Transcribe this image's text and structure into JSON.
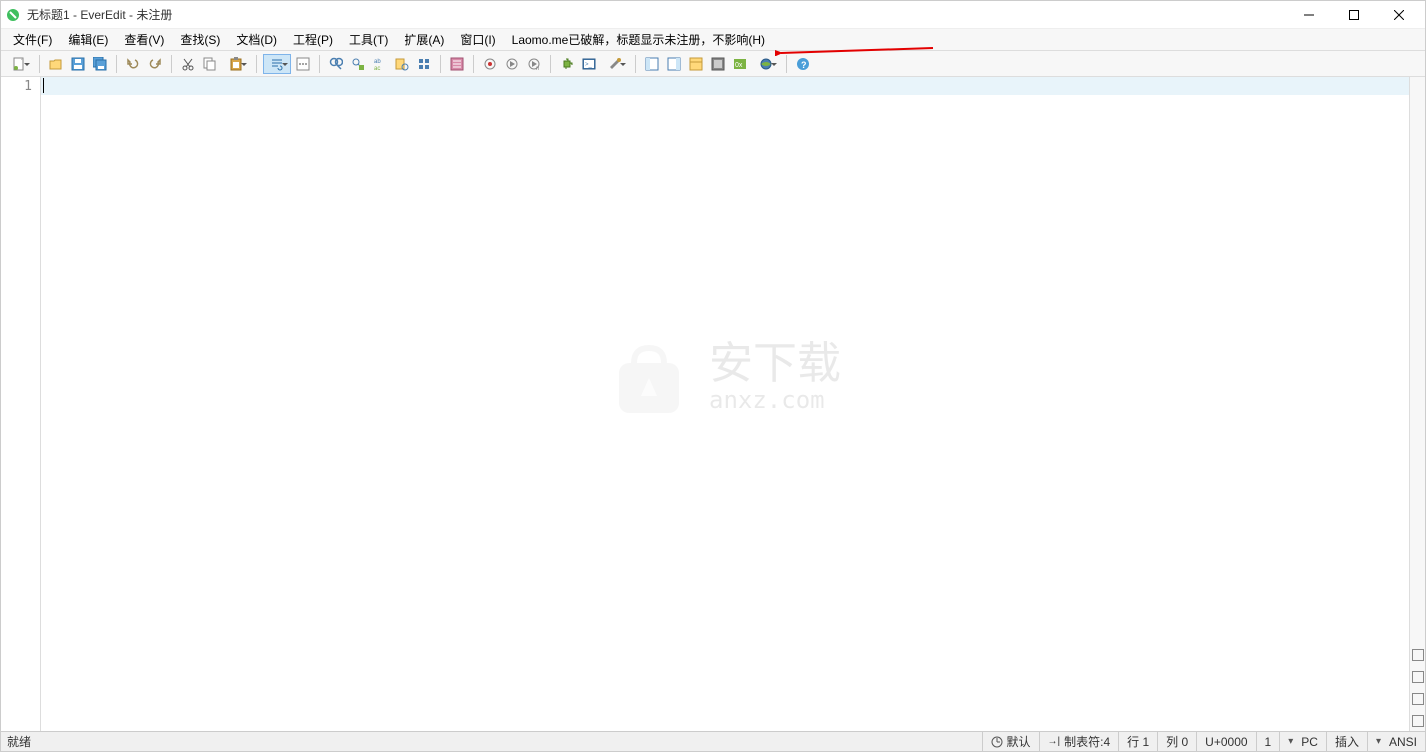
{
  "title": "无标题1 - EverEdit - 未注册",
  "menus": {
    "file": "文件(F)",
    "edit": "编辑(E)",
    "view": "查看(V)",
    "search": "查找(S)",
    "doc": "文档(D)",
    "project": "工程(P)",
    "tool": "工具(T)",
    "ext": "扩展(A)",
    "window": "窗口(I)",
    "help": "Laomo.me已破解，标题显示未注册，不影响(H)"
  },
  "line_number": "1",
  "watermark": {
    "text": "安下载",
    "sub": "anxz.com"
  },
  "status": {
    "ready": "就绪",
    "mode_default": "默认",
    "tab_label": "制表符:4",
    "row": "行 1",
    "col": "列 0",
    "unicode": "U+0000",
    "page": "1",
    "linebreak": "PC",
    "insert": "插入",
    "encoding": "ANSI"
  }
}
